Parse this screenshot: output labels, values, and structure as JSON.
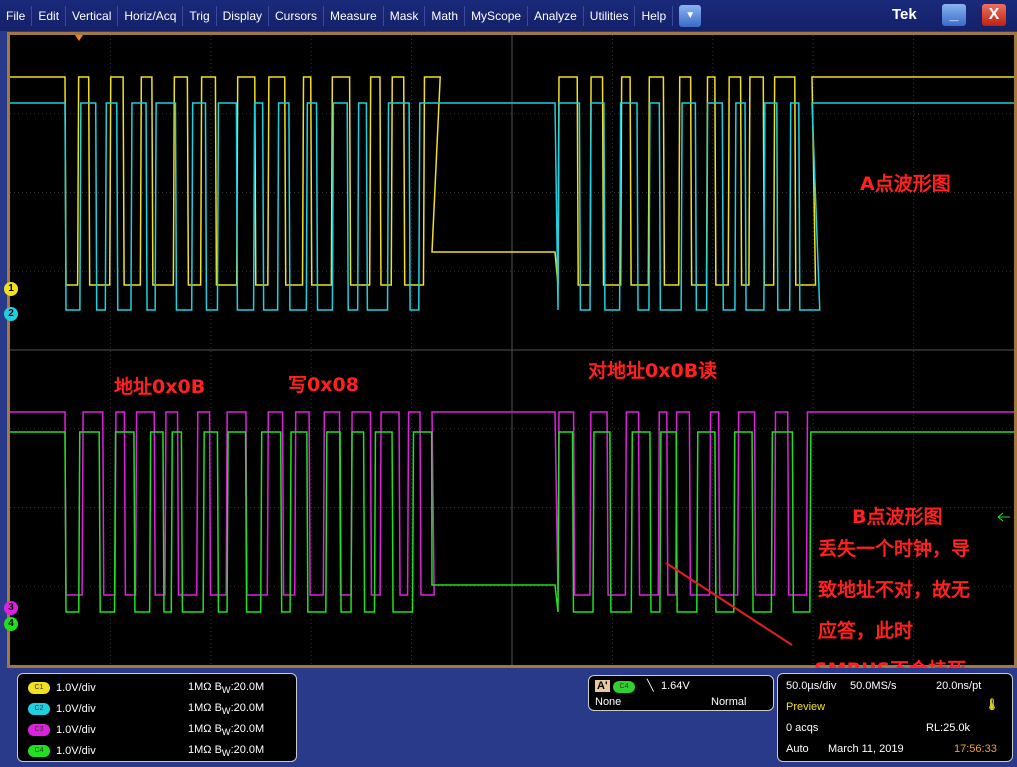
{
  "menu": [
    "File",
    "Edit",
    "Vertical",
    "Horiz/Acq",
    "Trig",
    "Display",
    "Cursors",
    "Measure",
    "Mask",
    "Math",
    "MyScope",
    "Analyze",
    "Utilities",
    "Help"
  ],
  "brand": "Tek",
  "window_buttons": {
    "minimize": "_",
    "close": "X",
    "dropdown": "▼"
  },
  "channel_colors": {
    "c1": "#f0e020",
    "c2": "#20d0e0",
    "c3": "#e020e0",
    "c4": "#20e020"
  },
  "markers": {
    "c1": "1",
    "c2": "2",
    "c3": "3",
    "c4": "4"
  },
  "annotations": {
    "a_waveform": "A点波形图",
    "addr": "地址0x0B",
    "write": "写0x08",
    "read": "对地址0x0B读",
    "b_waveform": "B点波形图",
    "explain": [
      "丢失一个时钟，导",
      "致地址不对，故无",
      "应答，此时",
      "SMBUS不会挂死"
    ]
  },
  "channels": [
    {
      "label": "C1",
      "scale": "1.0V/div",
      "impedance": "1MΩ",
      "bw": "20.0M"
    },
    {
      "label": "C2",
      "scale": "1.0V/div",
      "impedance": "1MΩ",
      "bw": "20.0M"
    },
    {
      "label": "C3",
      "scale": "1.0V/div",
      "impedance": "1MΩ",
      "bw": "20.0M"
    },
    {
      "label": "C4",
      "scale": "1.0V/div",
      "impedance": "1MΩ",
      "bw": "20.0M"
    }
  ],
  "trigger": {
    "label": "A'",
    "source": "C4",
    "level": "1.64V",
    "coupling": "None",
    "mode": "Normal"
  },
  "acq": {
    "timebase": "50.0µs/div",
    "rate": "50.0MS/s",
    "resolution": "20.0ns/pt",
    "state": "Preview",
    "acqs": "0 acqs",
    "rl": "RL:25.0k",
    "mode": "Auto",
    "date": "March 11, 2019",
    "time": "17:56:33"
  }
}
